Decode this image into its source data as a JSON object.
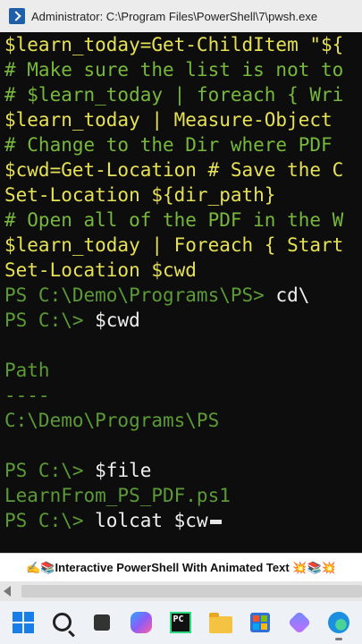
{
  "window": {
    "title": "Administrator: C:\\Program Files\\PowerShell\\7\\pwsh.exe"
  },
  "terminal": {
    "lines": [
      {
        "kind": "var",
        "text": "$learn_today=Get-ChildItem \"${"
      },
      {
        "kind": "comment",
        "text": "# Make sure the list is not to"
      },
      {
        "kind": "comment",
        "text": "# $learn_today | foreach { Wri"
      },
      {
        "kind": "var",
        "text": "$learn_today | Measure-Object "
      },
      {
        "kind": "comment",
        "text": "# Change to the Dir where PDF "
      },
      {
        "kind": "var",
        "text": "$cwd=Get-Location # Save the C"
      },
      {
        "kind": "var",
        "text": "Set-Location ${dir_path}"
      },
      {
        "kind": "comment",
        "text": "# Open all of the PDF in the W"
      },
      {
        "kind": "var",
        "text": "$learn_today | Foreach { Start"
      },
      {
        "kind": "var",
        "text": "Set-Location $cwd"
      },
      {
        "kind": "prompt",
        "prompt": "PS C:\\Demo\\Programs\\PS> ",
        "cmd": "cd\\"
      },
      {
        "kind": "prompt",
        "prompt": "PS C:\\> ",
        "cmd": "$cwd"
      },
      {
        "kind": "blank",
        "text": ""
      },
      {
        "kind": "output",
        "text": "Path"
      },
      {
        "kind": "output",
        "text": "----"
      },
      {
        "kind": "output",
        "text": "C:\\Demo\\Programs\\PS"
      },
      {
        "kind": "blank",
        "text": ""
      },
      {
        "kind": "prompt",
        "prompt": "PS C:\\> ",
        "cmd": "$file"
      },
      {
        "kind": "output",
        "text": "LearnFrom_PS_PDF.ps1"
      },
      {
        "kind": "prompt",
        "prompt": "PS C:\\> ",
        "cmd": "lolcat $cw"
      }
    ]
  },
  "caption": {
    "text": "✍️📚Interactive PowerShell With Animated Text 💥📚💥"
  },
  "taskbar": {
    "icons": [
      "windows-start-icon",
      "search-icon",
      "task-view-icon",
      "copilot-icon",
      "pycharm-icon",
      "file-explorer-icon",
      "microsoft-store-icon",
      "app-icon",
      "edge-icon"
    ],
    "pycharm_label": "PC"
  },
  "colors": {
    "terminal_bg": "#0d0d0d",
    "code_yellow": "#e6e155",
    "comment_green": "#77b83c",
    "prompt_green": "#5b9a36",
    "command_white": "#f0f0f0"
  }
}
